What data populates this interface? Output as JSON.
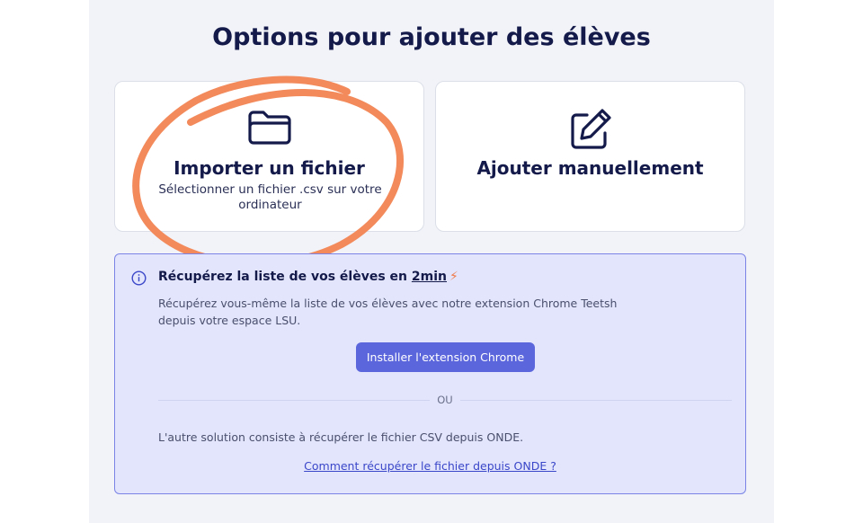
{
  "page": {
    "title": "Options pour ajouter des élèves"
  },
  "cards": {
    "import": {
      "title": "Importer un fichier",
      "subtitle": "Sélectionner un fichier .csv sur votre ordinateur",
      "icon": "folder-icon"
    },
    "manual": {
      "title": "Ajouter manuellement",
      "icon": "edit-icon"
    }
  },
  "info": {
    "title_prefix": "Récupérez la liste de vos élèves en ",
    "title_highlight": "2min",
    "bolt": "⚡",
    "description": "Récupérez vous-même la liste de vos élèves avec notre extension Chrome Teetsh depuis votre espace LSU.",
    "install_button": "Installer l'extension Chrome",
    "or_label": "OU",
    "alternative": "L'autre solution consiste à récupérer le fichier CSV depuis ONDE.",
    "onde_link": "Comment récupérer le fichier depuis ONDE ?"
  },
  "colors": {
    "accent": "#5b66dc",
    "annotation": "#f28a5b",
    "info_bg": "#e2e5fb",
    "info_border": "#7b84e6"
  }
}
